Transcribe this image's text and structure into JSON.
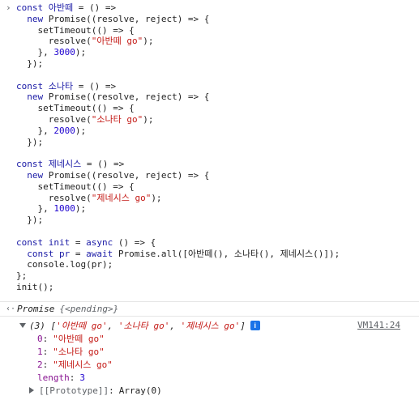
{
  "prompt_symbol": "›",
  "code_lines": [
    [
      {
        "t": "kw",
        "s": "const "
      },
      {
        "t": "var",
        "s": "아반떼"
      },
      {
        "t": "plain",
        "s": " = () =>"
      }
    ],
    [
      {
        "t": "plain",
        "s": "  "
      },
      {
        "t": "kw",
        "s": "new "
      },
      {
        "t": "plain",
        "s": "Promise((resolve, reject) => {"
      }
    ],
    [
      {
        "t": "plain",
        "s": "    setTimeout(() => {"
      }
    ],
    [
      {
        "t": "plain",
        "s": "      resolve("
      },
      {
        "t": "str",
        "s": "\"아반떼 go\""
      },
      {
        "t": "plain",
        "s": ");"
      }
    ],
    [
      {
        "t": "plain",
        "s": "    }, "
      },
      {
        "t": "num",
        "s": "3000"
      },
      {
        "t": "plain",
        "s": ");"
      }
    ],
    [
      {
        "t": "plain",
        "s": "  });"
      }
    ],
    [
      {
        "t": "plain",
        "s": ""
      }
    ],
    [
      {
        "t": "kw",
        "s": "const "
      },
      {
        "t": "var",
        "s": "소나타"
      },
      {
        "t": "plain",
        "s": " = () =>"
      }
    ],
    [
      {
        "t": "plain",
        "s": "  "
      },
      {
        "t": "kw",
        "s": "new "
      },
      {
        "t": "plain",
        "s": "Promise((resolve, reject) => {"
      }
    ],
    [
      {
        "t": "plain",
        "s": "    setTimeout(() => {"
      }
    ],
    [
      {
        "t": "plain",
        "s": "      resolve("
      },
      {
        "t": "str",
        "s": "\"소나타 go\""
      },
      {
        "t": "plain",
        "s": ");"
      }
    ],
    [
      {
        "t": "plain",
        "s": "    }, "
      },
      {
        "t": "num",
        "s": "2000"
      },
      {
        "t": "plain",
        "s": ");"
      }
    ],
    [
      {
        "t": "plain",
        "s": "  });"
      }
    ],
    [
      {
        "t": "plain",
        "s": ""
      }
    ],
    [
      {
        "t": "kw",
        "s": "const "
      },
      {
        "t": "var",
        "s": "제네시스"
      },
      {
        "t": "plain",
        "s": " = () =>"
      }
    ],
    [
      {
        "t": "plain",
        "s": "  "
      },
      {
        "t": "kw",
        "s": "new "
      },
      {
        "t": "plain",
        "s": "Promise((resolve, reject) => {"
      }
    ],
    [
      {
        "t": "plain",
        "s": "    setTimeout(() => {"
      }
    ],
    [
      {
        "t": "plain",
        "s": "      resolve("
      },
      {
        "t": "str",
        "s": "\"제네시스 go\""
      },
      {
        "t": "plain",
        "s": ");"
      }
    ],
    [
      {
        "t": "plain",
        "s": "    }, "
      },
      {
        "t": "num",
        "s": "1000"
      },
      {
        "t": "plain",
        "s": ");"
      }
    ],
    [
      {
        "t": "plain",
        "s": "  });"
      }
    ],
    [
      {
        "t": "plain",
        "s": ""
      }
    ],
    [
      {
        "t": "kw",
        "s": "const "
      },
      {
        "t": "var",
        "s": "init"
      },
      {
        "t": "plain",
        "s": " = "
      },
      {
        "t": "kw",
        "s": "async "
      },
      {
        "t": "plain",
        "s": "() => {"
      }
    ],
    [
      {
        "t": "plain",
        "s": "  "
      },
      {
        "t": "kw",
        "s": "const "
      },
      {
        "t": "var",
        "s": "pr"
      },
      {
        "t": "plain",
        "s": " = "
      },
      {
        "t": "kw",
        "s": "await "
      },
      {
        "t": "plain",
        "s": "Promise.all([아반떼(), 소나타(), 제네시스()]);"
      }
    ],
    [
      {
        "t": "plain",
        "s": "  console.log(pr);"
      }
    ],
    [
      {
        "t": "plain",
        "s": "};"
      }
    ],
    [
      {
        "t": "plain",
        "s": "init();"
      }
    ]
  ],
  "result": {
    "arrow": "‹·",
    "type": "Promise",
    "state": "{<pending>}"
  },
  "log": {
    "summary_count": "(3) [",
    "items": [
      "'아반떼 go'",
      "'소나타 go'",
      "'제네시스 go'"
    ],
    "summary_close": "]",
    "info_badge": "i",
    "source": "VM141:24",
    "props": [
      {
        "key": "0",
        "value": "\"아반떼 go\""
      },
      {
        "key": "1",
        "value": "\"소나타 go\""
      },
      {
        "key": "2",
        "value": "\"제네시스 go\""
      }
    ],
    "length_key": "length",
    "length_value": "3",
    "proto_key": "[[Prototype]]",
    "proto_value": "Array(0)"
  },
  "colors": {
    "keyword": "#1a1aa6",
    "string": "#c41a16",
    "number": "#1c00cf",
    "property_key": "#881391",
    "link": "#5f6368",
    "badge": "#1a73e8"
  }
}
